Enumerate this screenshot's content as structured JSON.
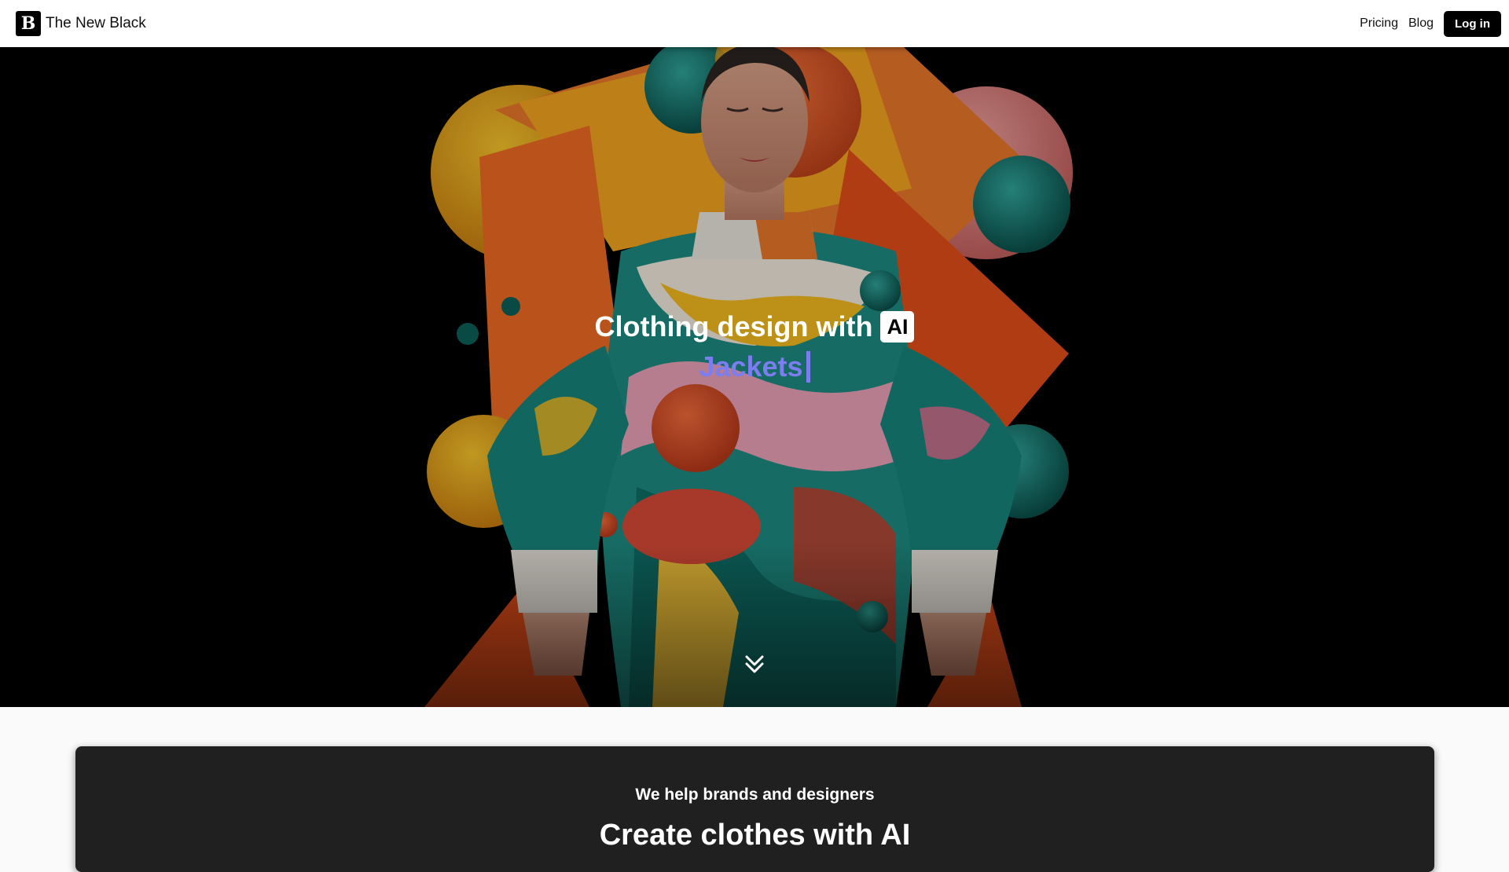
{
  "navbar": {
    "logo_glyph": "B",
    "brand_name": "The New Black",
    "links": [
      "Pricing",
      "Blog"
    ],
    "login_label": "Log in"
  },
  "hero": {
    "title": "Clothing design with",
    "ai_badge": "AI",
    "typed_word": "Jackets",
    "accent_color": "#7b7df0",
    "scroll_icon": "double-chevron-down-icon"
  },
  "section": {
    "eyebrow": "We help brands and designers",
    "heading": "Create clothes with AI"
  }
}
